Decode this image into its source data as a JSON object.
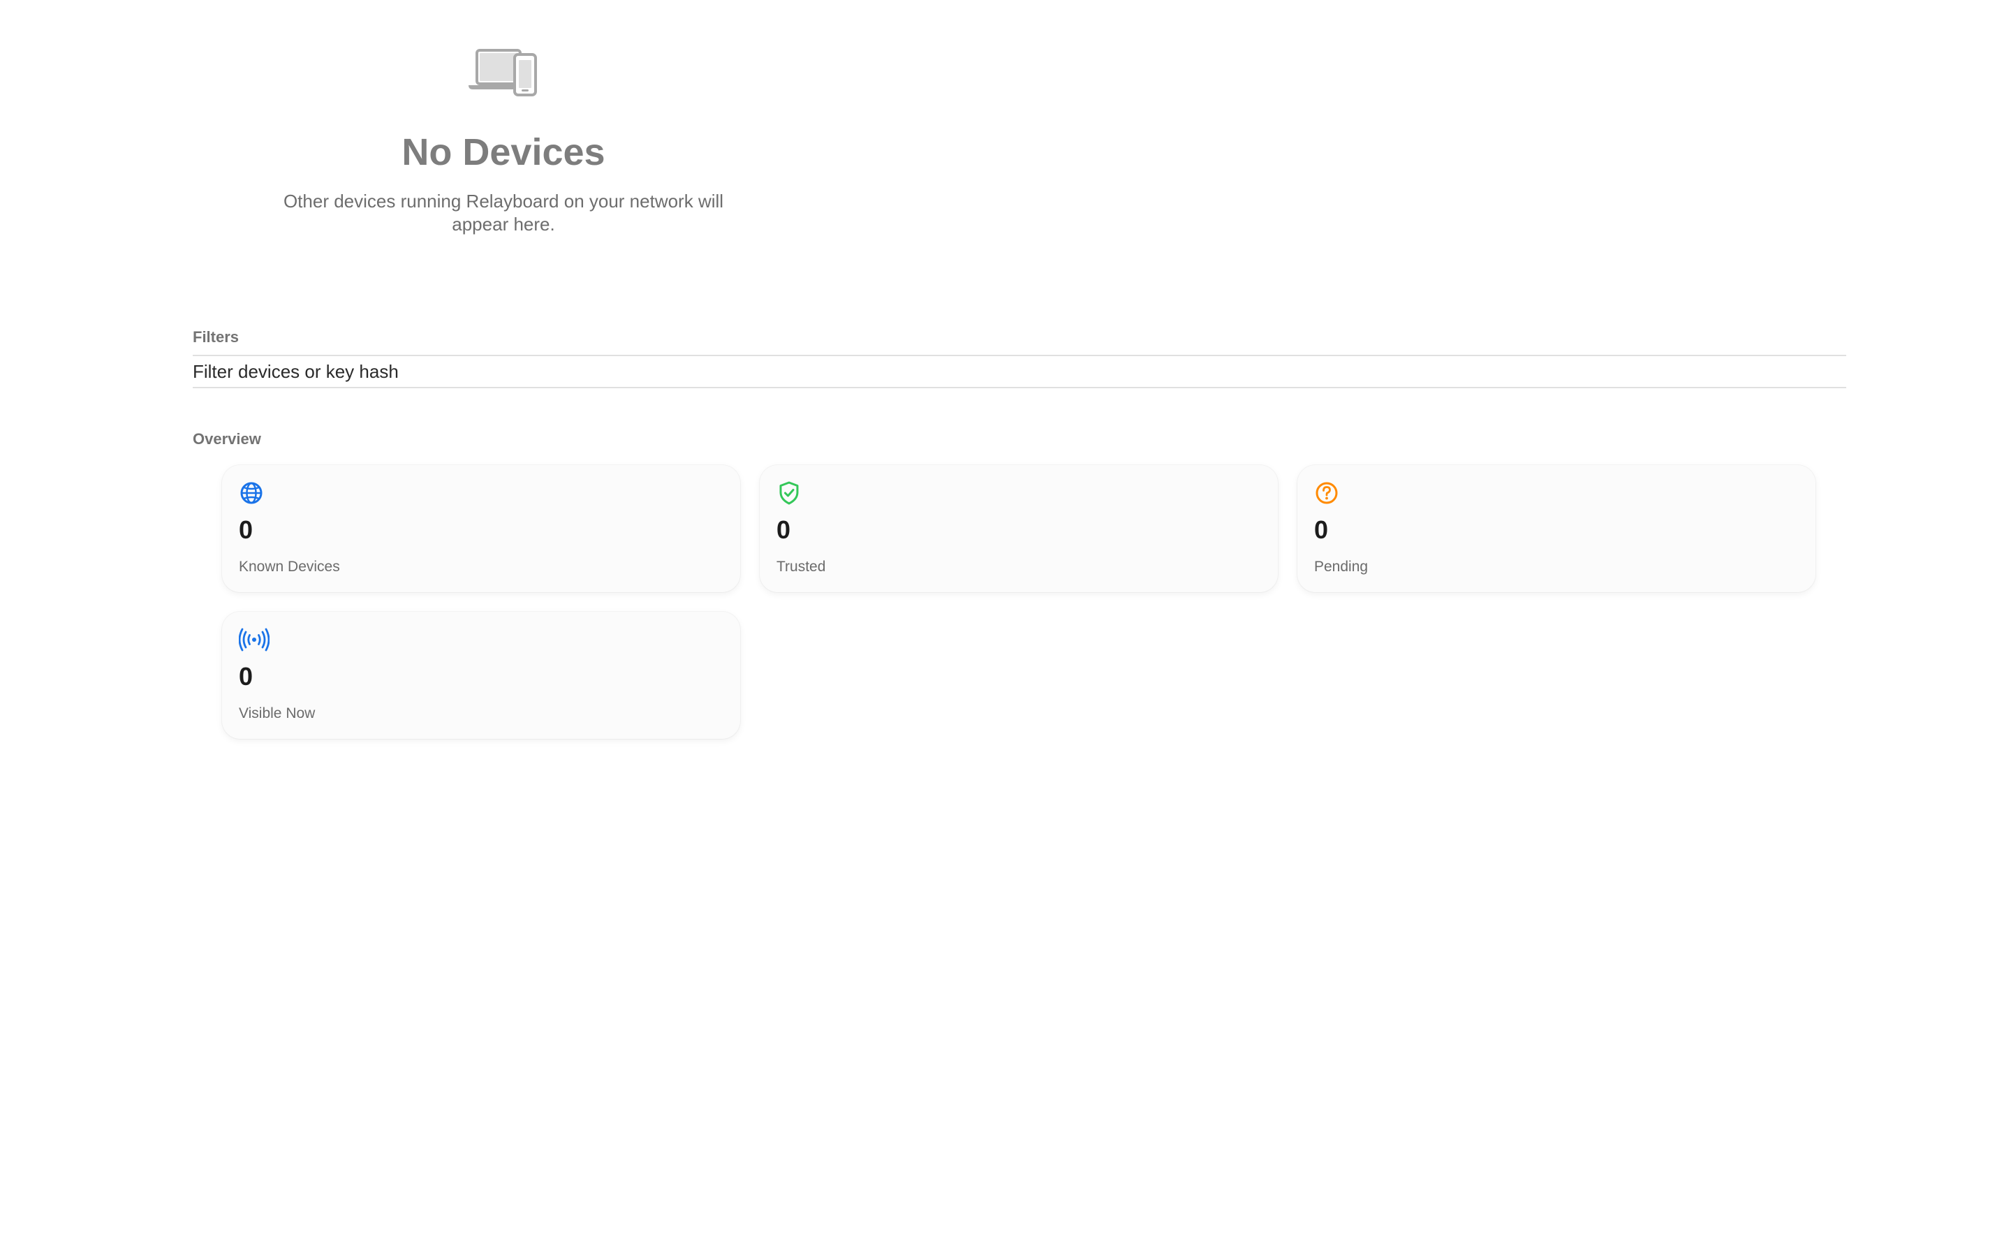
{
  "empty_state": {
    "icon": "laptop-and-phone-icon",
    "title": "No Devices",
    "description": "Other devices running Relayboard on your network will appear here."
  },
  "filters": {
    "label": "Filters",
    "placeholder": "Filter devices or key hash",
    "value": ""
  },
  "overview": {
    "label": "Overview",
    "cards": [
      {
        "icon": "globe-icon",
        "value": "0",
        "label": "Known Devices",
        "color": "#1a73e8"
      },
      {
        "icon": "shield-check-icon",
        "value": "0",
        "label": "Trusted",
        "color": "#34c759"
      },
      {
        "icon": "question-circle-icon",
        "value": "0",
        "label": "Pending",
        "color": "#ff8a00"
      },
      {
        "icon": "broadcast-icon",
        "value": "0",
        "label": "Visible Now",
        "color": "#1a73e8"
      }
    ]
  },
  "colors": {
    "muted_title": "#7d7d7d",
    "accent_blue": "#1a73e8",
    "accent_green": "#34c759",
    "accent_orange": "#ff8a00"
  }
}
